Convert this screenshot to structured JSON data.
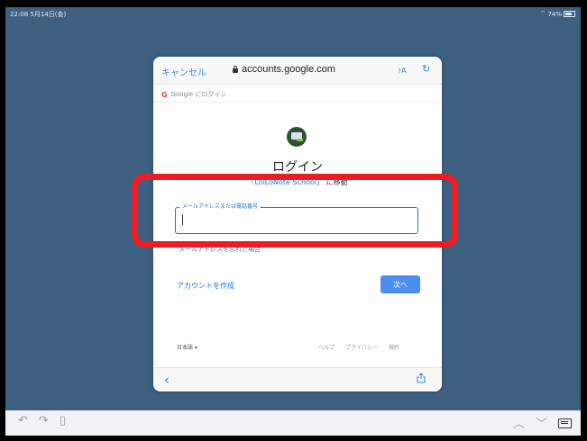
{
  "status_bar": {
    "time": "22:08  5月14日(金)",
    "battery": "74%"
  },
  "browser": {
    "cancel_label": "キャンセル",
    "url": "accounts.google.com",
    "text_size_label": "ｧA",
    "reload_icon": "reload-icon"
  },
  "google_bar": {
    "label": "Google にログイン"
  },
  "page": {
    "title": "ログイン",
    "app_name": "「LoiLoNote School」",
    "goto_suffix": "に移動",
    "field_label": "メールアドレスまたは電話番号",
    "field_value": "",
    "forgot_link": "メールアドレスを忘れた場合",
    "create_account": "アカウントを作成",
    "next_button": "次へ"
  },
  "footer": {
    "language": "日本語 ▾",
    "links": [
      "ヘルプ",
      "プライバシー",
      "規約"
    ]
  },
  "colors": {
    "accent": "#1a73e8",
    "highlight": "#ec1c24",
    "background": "#3d5f80"
  }
}
